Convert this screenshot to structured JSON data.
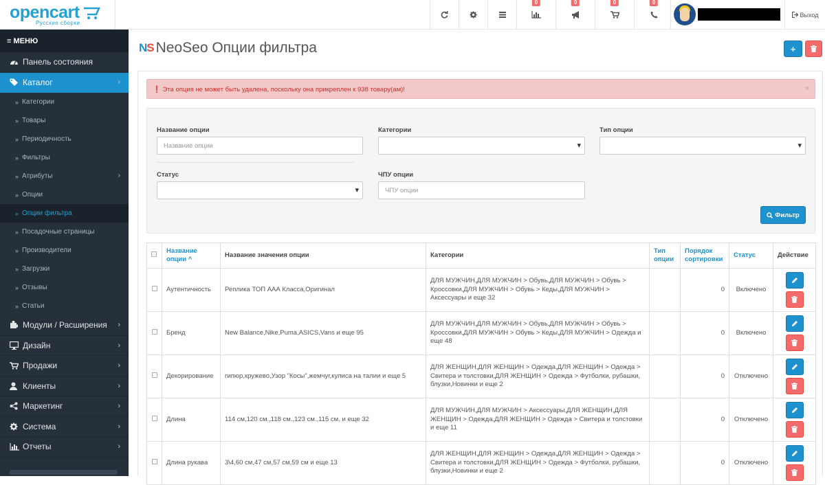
{
  "header": {
    "logo_brand": "opencart",
    "logo_sub": "Русские сборки",
    "badges": {
      "reports": "0",
      "marketing": "0",
      "cart": "0",
      "phone": "0"
    },
    "logout_label": "Выход"
  },
  "sidebar": {
    "menu_label": "МЕНЮ",
    "items": [
      {
        "label": "Панель состояния",
        "icon": "dashboard-icon"
      },
      {
        "label": "Каталог",
        "icon": "tag-icon"
      },
      {
        "label": "Модули / Расширения",
        "icon": "puzzle-icon"
      },
      {
        "label": "Дизайн",
        "icon": "desktop-icon"
      },
      {
        "label": "Продажи",
        "icon": "cart-icon"
      },
      {
        "label": "Клиенты",
        "icon": "user-icon"
      },
      {
        "label": "Маркетинг",
        "icon": "share-icon"
      },
      {
        "label": "Система",
        "icon": "gear-icon"
      },
      {
        "label": "Отчеты",
        "icon": "bar-chart-icon"
      }
    ],
    "catalog_sub": [
      "Категории",
      "Товары",
      "Периодичность",
      "Фильтры",
      "Атрибуты",
      "Опции",
      "Опции фильтра",
      "Посадочные страницы",
      "Производители",
      "Загрузки",
      "Отзывы",
      "Статьи"
    ]
  },
  "page": {
    "logo_mark": "NS",
    "title": "NeoSeo Опции фильтра",
    "alert": "Эта опция не может быть удалена, поскольку она прикреплен к 938 товару(ам)!",
    "alert_close": "×"
  },
  "filter": {
    "name_label": "Название опции",
    "name_placeholder": "Название опции",
    "categories_label": "Категории",
    "type_label": "Тип опции",
    "status_label": "Статус",
    "seo_label": "ЧПУ опции",
    "seo_placeholder": "ЧПУ опции",
    "button": "Фильтр"
  },
  "table": {
    "headers": {
      "name": "Название опции ^",
      "values": "Название значения опции",
      "categories": "Категории",
      "type": "Тип опции",
      "sort": "Порядок сортировки",
      "status": "Статус",
      "action": "Действие"
    },
    "rows": [
      {
        "name": "Аутентичность",
        "values": "Реплика ТОП ААА Класса,Оригинал",
        "categories": "ДЛЯ МУЖЧИН,ДЛЯ МУЖЧИН  >  Обувь,ДЛЯ МУЖЧИН  >  Обувь  >  Кроссовки,ДЛЯ МУЖЧИН  >  Обувь  >  Кеды,ДЛЯ МУЖЧИН  >  Аксессуары и еще 32",
        "type": "",
        "sort": "0",
        "status": "Включено"
      },
      {
        "name": "Бренд",
        "values": "New Balance,Nike,Puma,ASICS,Vans и еще 95",
        "categories": "ДЛЯ МУЖЧИН,ДЛЯ МУЖЧИН  >  Обувь,ДЛЯ МУЖЧИН  >  Обувь  >  Кроссовки,ДЛЯ МУЖЧИН  >  Обувь  >  Кеды,ДЛЯ МУЖЧИН  >  Одежда и еще 48",
        "type": "",
        "sort": "0",
        "status": "Включено"
      },
      {
        "name": "Декорирование",
        "values": "гипюр,кружево,Узор \"Косы\",жемчуг,кулиса на талии и еще 5",
        "categories": "ДЛЯ ЖЕНЩИН,ДЛЯ ЖЕНЩИН  >  Одежда,ДЛЯ ЖЕНЩИН  >  Одежда  >  Свитера и толстовки,ДЛЯ ЖЕНЩИН  >  Одежда  >  Футболки, рубашки, блузки,Новинки и еще 2",
        "type": "",
        "sort": "0",
        "status": "Отключено"
      },
      {
        "name": "Длина",
        "values": "114 см,120 см.,118 см.,123 см.,115 см. и еще 32",
        "categories": "ДЛЯ МУЖЧИН,ДЛЯ МУЖЧИН  >  Аксессуары,ДЛЯ ЖЕНЩИН,ДЛЯ ЖЕНЩИН  >  Одежда,ДЛЯ ЖЕНЩИН  >  Одежда  >  Свитера и толстовки и еще 11",
        "type": "",
        "sort": "0",
        "status": "Отключено"
      },
      {
        "name": "Длина рукава",
        "values": "3\\4,60 см,47 см,57 см,59 см и еще 13",
        "categories": "ДЛЯ ЖЕНЩИН,ДЛЯ ЖЕНЩИН  >  Одежда,ДЛЯ ЖЕНЩИН  >  Одежда  >  Свитера и толстовки,ДЛЯ ЖЕНЩИН  >  Одежда  >  Футболки, рубашки, блузки,Новинки и еще 2",
        "type": "",
        "sort": "0",
        "status": "Отключено"
      }
    ]
  },
  "colors": {
    "primary": "#1e91cf",
    "danger": "#f56b6b",
    "sidebar": "#25303b",
    "alert_bg": "#f2c8c8"
  }
}
